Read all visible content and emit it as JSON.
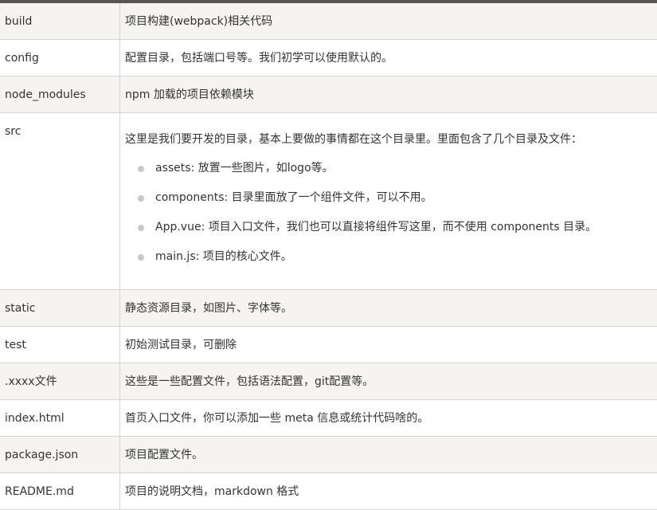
{
  "rows": [
    {
      "name": "build",
      "desc": "项目构建(webpack)相关代码"
    },
    {
      "name": "config",
      "desc": "配置目录，包括端口号等。我们初学可以使用默认的。"
    },
    {
      "name": "node_modules",
      "desc": "npm 加载的项目依赖模块"
    },
    {
      "name": "src",
      "desc": "这里是我们要开发的目录，基本上要做的事情都在这个目录里。里面包含了几个目录及文件：",
      "items": [
        "assets: 放置一些图片，如logo等。",
        "components: 目录里面放了一个组件文件，可以不用。",
        "App.vue: 项目入口文件，我们也可以直接将组件写这里，而不使用 components 目录。",
        "main.js: 项目的核心文件。"
      ]
    },
    {
      "name": "static",
      "desc": "静态资源目录，如图片、字体等。"
    },
    {
      "name": "test",
      "desc": "初始测试目录，可删除"
    },
    {
      "name": ".xxxx文件",
      "desc": "这些是一些配置文件，包括语法配置，git配置等。"
    },
    {
      "name": "index.html",
      "desc": "首页入口文件，你可以添加一些 meta 信息或统计代码啥的。"
    },
    {
      "name": "package.json",
      "desc": "项目配置文件。"
    },
    {
      "name": "README.md",
      "desc": "项目的说明文档，markdown 格式"
    }
  ]
}
